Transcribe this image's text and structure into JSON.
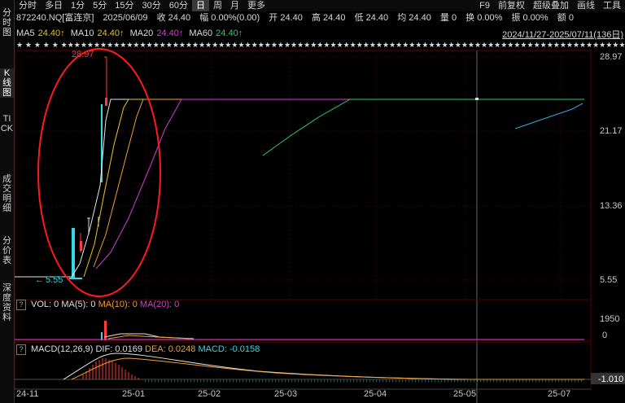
{
  "toolbar": {
    "periods": [
      "分时",
      "多日",
      "1分",
      "5分",
      "15分",
      "30分",
      "60分",
      "日",
      "周",
      "月",
      "更多"
    ],
    "active_period": "日",
    "right_items": [
      "F9",
      "前复权",
      "超级叠加",
      "画线",
      "工具"
    ]
  },
  "leftbar": {
    "items": [
      "分时图",
      "K线图",
      "TICK",
      "成交明细",
      "分价表",
      "深度资料"
    ]
  },
  "info": {
    "code": "872240.NQ[富连京]",
    "date": "2025/06/09",
    "close": "收 24.40",
    "change": "幅 0.00%(0.00)",
    "open": "开 24.40",
    "high": "高 24.40",
    "low": "低 24.40",
    "avg": "均 24.40",
    "volume": "量 0",
    "turnover": "换 0.00%",
    "amplitude": "振 0.00%",
    "amount": "额 0"
  },
  "ma": {
    "ma5_label": "MA5",
    "ma5_value": "24.40↑",
    "ma10_label": "MA10",
    "ma10_value": "24.40↑",
    "ma20_label": "MA20",
    "ma20_value": "24.40↑",
    "ma60_label": "MA60",
    "ma60_value": "24.40↑",
    "range": "2024/11/27-2025/07/11(136日)"
  },
  "colors": {
    "up": "#ff3b3b",
    "down": "#33d9e6",
    "ma5": "#e6e6e6",
    "ma10": "#f0c020",
    "ma20": "#d040d0",
    "ma60": "#33cc66",
    "grid": "#3a0000",
    "annotation": "#ff1a1a"
  },
  "chart_data": [
    {
      "type": "candlestick",
      "y_ticks": [
        "28.97",
        "21.17",
        "13.36",
        "5.55"
      ],
      "ylim": [
        5.55,
        28.97
      ],
      "x_ticks": [
        "24-11",
        "25-01",
        "25-02",
        "25-03",
        "25-04",
        "25-05",
        "25-07"
      ],
      "annotations": {
        "high": "28.97",
        "low": "5.55"
      }
    },
    {
      "type": "bar",
      "header": {
        "title": "VOL: 0",
        "ma5": "MA(5): 0",
        "ma10": "MA(10): 0",
        "ma20": "MA(20): 0"
      },
      "y_ticks": [
        "1950",
        "0"
      ]
    },
    {
      "type": "line",
      "header": {
        "title": "MACD(12,26,9)",
        "dif": "DIF: 0.0169",
        "dea": "DEA: 0.0248",
        "macd": "MACD: -0.0158"
      },
      "y_ticks": [
        "-1.010"
      ]
    }
  ]
}
